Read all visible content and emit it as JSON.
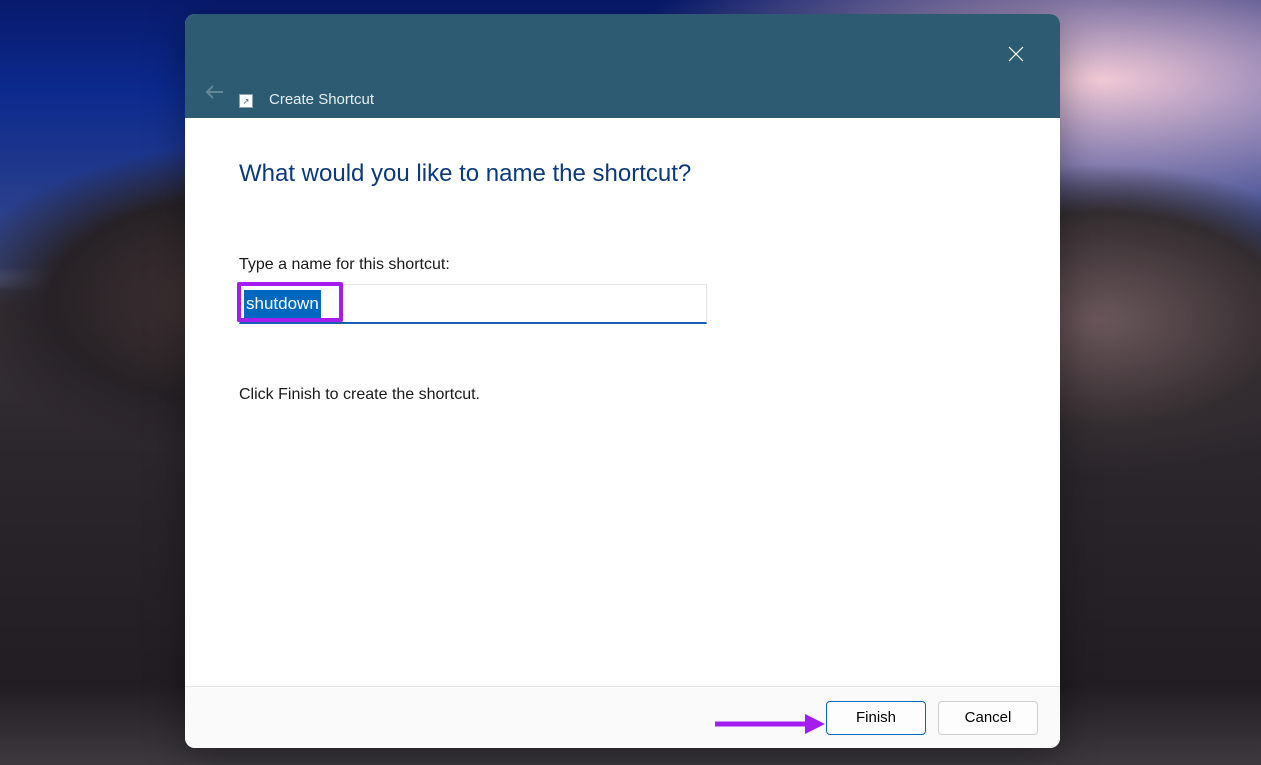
{
  "titlebar": {
    "title": "Create Shortcut"
  },
  "body": {
    "heading": "What would you like to name the shortcut?",
    "field_label": "Type a name for this shortcut:",
    "input_value": "shutdown",
    "instruction": "Click Finish to create the shortcut."
  },
  "footer": {
    "finish_label": "Finish",
    "cancel_label": "Cancel"
  },
  "annotation": {
    "highlight_color": "#a41cf0"
  }
}
